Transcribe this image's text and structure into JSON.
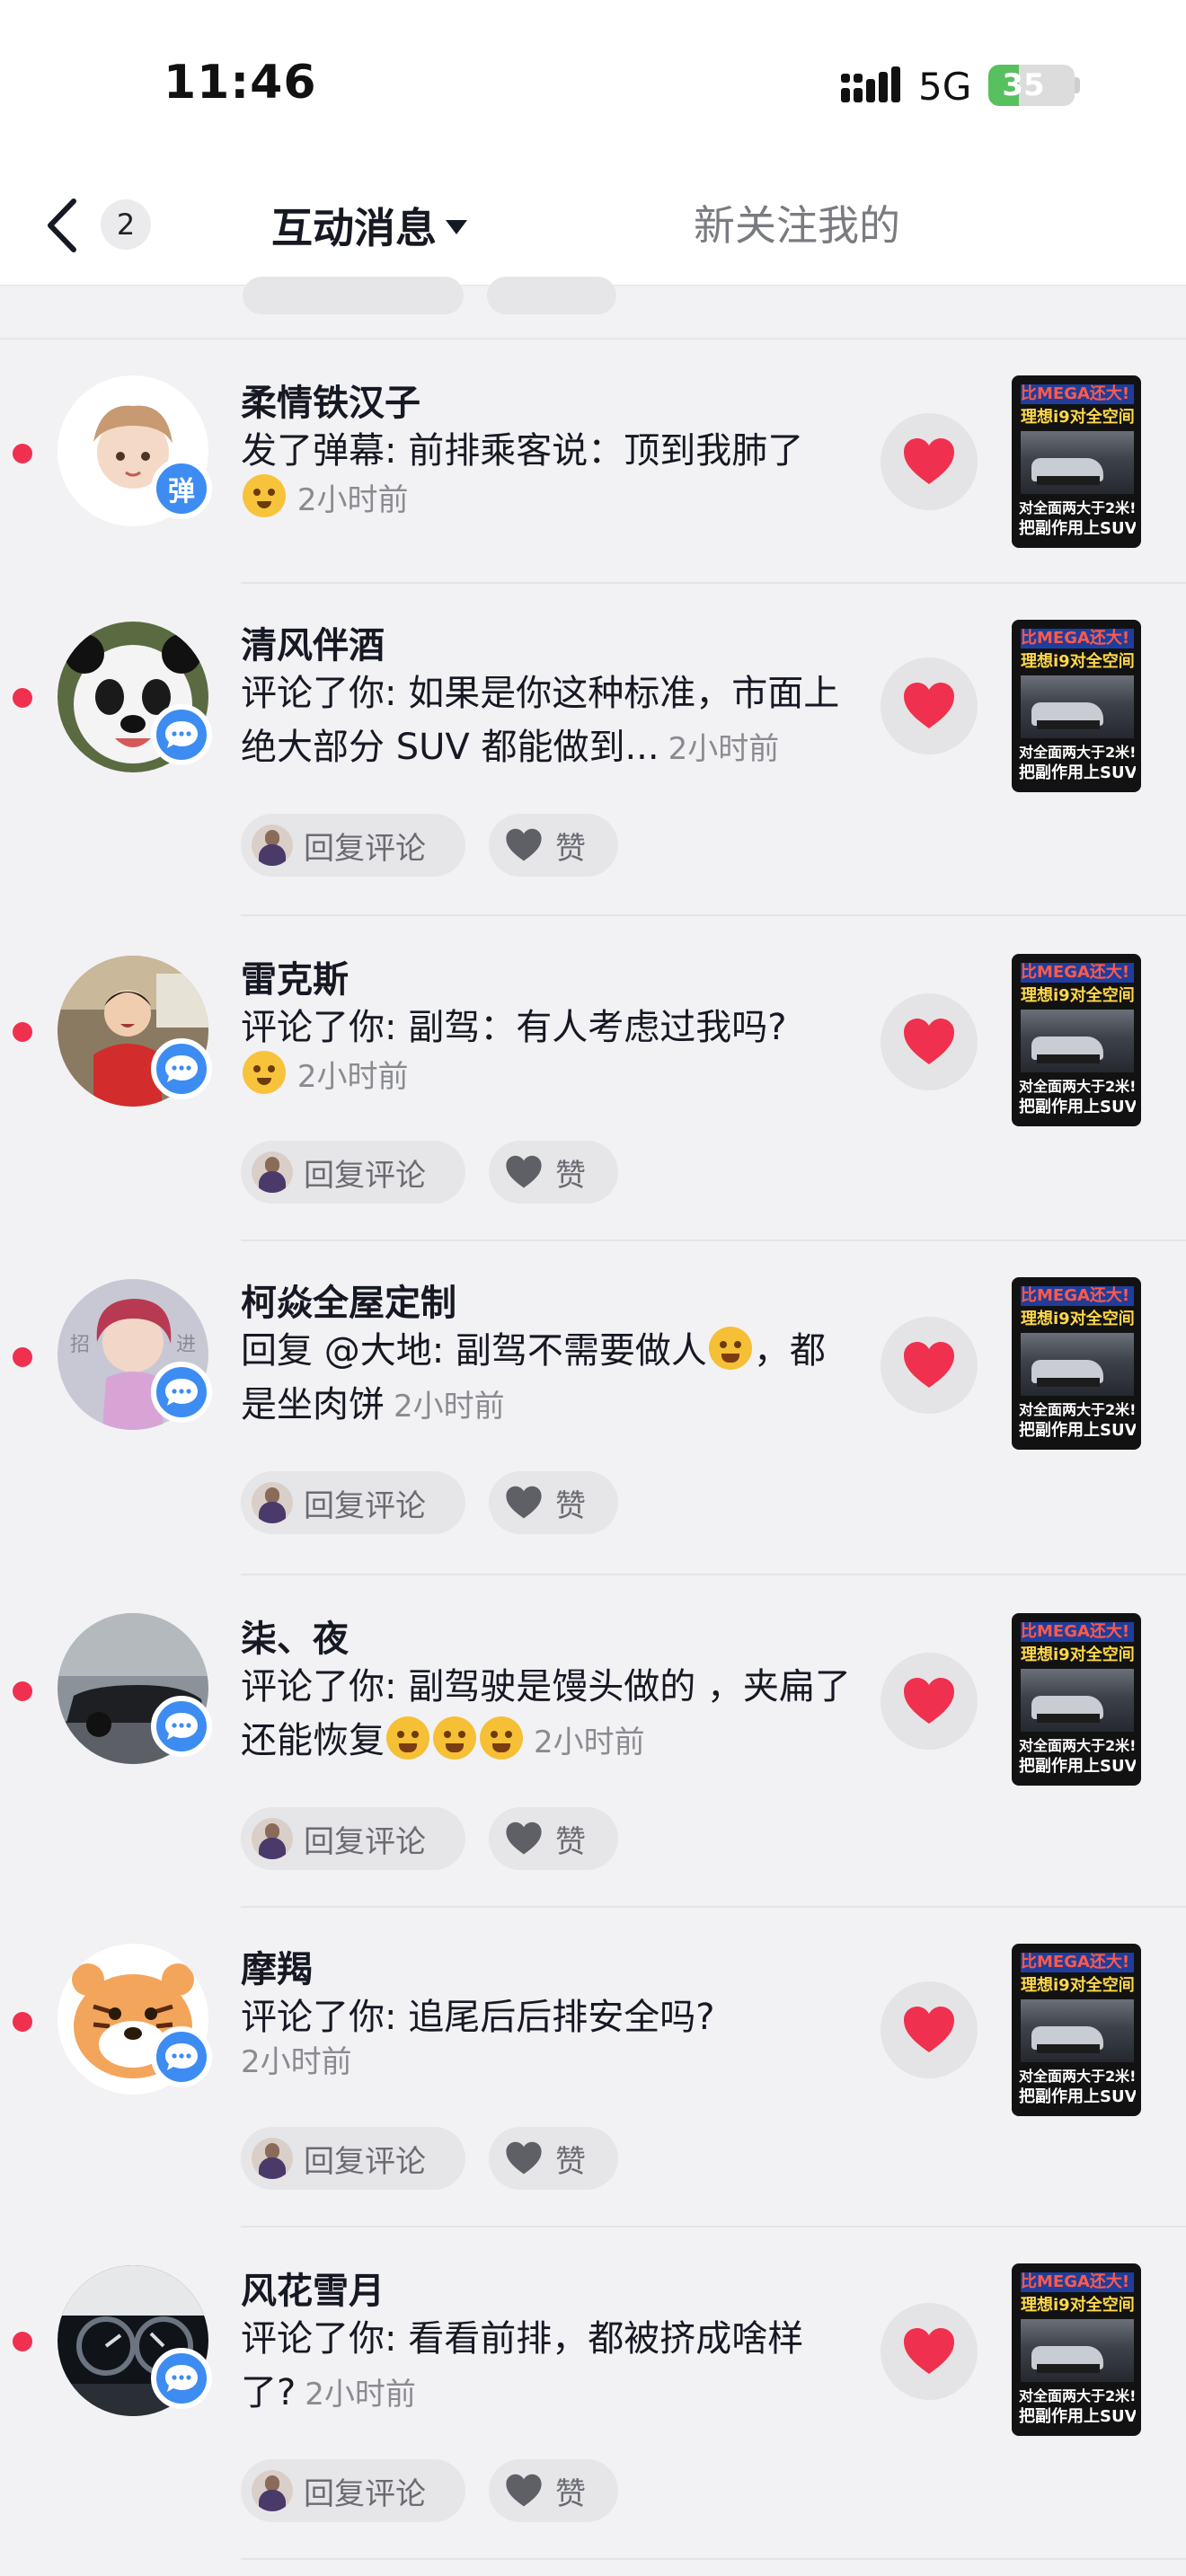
{
  "status_bar": {
    "time": "11:46",
    "network": "5G",
    "battery": "35",
    "battery_level": 0.35
  },
  "nav": {
    "back_count": "2",
    "tab_active": "互动消息",
    "tab_inactive": "新关注我的"
  },
  "actions": {
    "reply_label": "回复评论",
    "like_label": "赞"
  },
  "thumbnail": {
    "line1": "比MEGA还大!",
    "line2": "理想i9对全空间",
    "line3": "对全面两大于2米!",
    "line4": "把副作用上SUV!"
  },
  "messages": [
    {
      "name": "柔情铁汉子",
      "text": "发了弹幕: 前排乘客说：顶到我肺了",
      "time": "2小时前",
      "badge": "弹",
      "badge_type": "danmaku-icon",
      "emojis": [
        "flushed-emoji"
      ]
    },
    {
      "name": "清风伴酒",
      "text": "评论了你: 如果是你这种标准，市面上绝大部分 SUV 都能做到...",
      "time": "2小时前",
      "badge_type": "comment-icon"
    },
    {
      "name": "雷克斯",
      "text": "评论了你: 副驾：有人考虑过我吗?",
      "time": "2小时前",
      "badge_type": "comment-icon",
      "emojis": [
        "surprised-emoji"
      ]
    },
    {
      "name": "柯焱全屋定制",
      "text": "回复 @大地: 副驾不需要做人",
      "text_after": "，都是坐肉饼",
      "time": "2小时前",
      "badge_type": "comment-icon",
      "emojis": [
        "crying-laughing-emoji"
      ]
    },
    {
      "name": "柒、夜",
      "text": "评论了你: 副驾驶是馒头做的 ，夹扁了还能恢复",
      "time": "2小时前",
      "badge_type": "comment-icon",
      "emojis": [
        "crying-laughing-emoji",
        "crying-laughing-emoji",
        "crying-laughing-emoji"
      ]
    },
    {
      "name": "摩羯",
      "text": "评论了你: 追尾后后排安全吗?",
      "time": "2小时前",
      "badge_type": "comment-icon"
    },
    {
      "name": "风花雪月",
      "text": "评论了你: 看看前排，都被挤成啥样了?",
      "time": "2小时前",
      "badge_type": "comment-icon"
    }
  ],
  "colors": {
    "accent_blue": "#3d8cf2",
    "heart_red": "#f0304f",
    "unread_dot": "#f0304f",
    "battery_green": "#57c05f"
  }
}
